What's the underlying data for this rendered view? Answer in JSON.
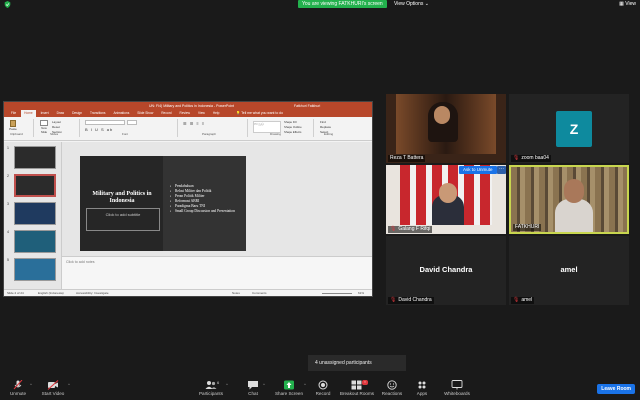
{
  "topbar": {
    "share_banner": "You are viewing FATKHURI's screen",
    "view_options": "View Options ⌄",
    "view": "View"
  },
  "powerpoint": {
    "window_title": "UN: FI4) Military and Politics in Indonesia  -  PowerPoint",
    "user": "Fatkhuri Fatkhuri",
    "tabs": [
      "File",
      "Home",
      "Insert",
      "Draw",
      "Design",
      "Transitions",
      "Animations",
      "Slide Show",
      "Record",
      "Review",
      "View",
      "Help"
    ],
    "active_tab": "Home",
    "tell_me": "Tell me what you want to do",
    "ribbon_groups": [
      "Clipboard",
      "Slides",
      "Font",
      "Paragraph",
      "Drawing",
      "Editing"
    ],
    "ribbon_items": {
      "paste": "Paste",
      "new_slide": "New Slide",
      "layout": "Layout",
      "reset": "Reset",
      "section": "Section",
      "shape_fill": "Shape Fill",
      "shape_outline": "Shape Outline",
      "shape_effects": "Shape Effects",
      "find": "Find",
      "replace": "Replace",
      "select": "Select"
    },
    "thumbnails": [
      {
        "num": "1",
        "color": "#2b2b2b",
        "selected": false
      },
      {
        "num": "2",
        "color": "#2b2b2b",
        "selected": true
      },
      {
        "num": "3",
        "color": "#1f3a5f",
        "selected": false
      },
      {
        "num": "4",
        "color": "#1f5f7a",
        "selected": false
      },
      {
        "num": "5",
        "color": "#2a6f9a",
        "selected": false
      }
    ],
    "slide": {
      "title": "Military and  Politics in Indonesia",
      "subtitle_placeholder": "Click to add subtitle",
      "bullets": [
        "Pendahuluan",
        "Relasi Militer dan Politik",
        "Peran Politik Militer",
        "Reformasi ABRI",
        "Paradigma Baru TNI",
        "Small Group Discussion and Presentation"
      ]
    },
    "notes_placeholder": "Click to add notes",
    "status": {
      "slide_count": "Slide 2 of 24",
      "language": "English (Indonesia)",
      "accessibility": "Accessibility: Investigate",
      "notes": "Notes",
      "comments": "Comments",
      "zoom": "61%"
    }
  },
  "participants_tiles": [
    {
      "name": "Reza T Battera",
      "type": "video",
      "muted": false
    },
    {
      "name": "zoom baa04",
      "type": "avatar",
      "initial": "Z",
      "muted": true
    },
    {
      "name": "Galang F Rifqi",
      "type": "video",
      "muted": true
    },
    {
      "name": "FATKHURI",
      "type": "video",
      "muted": false
    },
    {
      "name": "David Chandra",
      "type": "name",
      "muted": true
    },
    {
      "name": "amel",
      "type": "name",
      "muted": true
    }
  ],
  "unmute_button": "Ask to Unmute",
  "more_button": "···",
  "unassigned": "4 unassigned participants",
  "toolbar": {
    "unmute": "Unmute",
    "start_video": "Start Video",
    "participants": "Participants",
    "participants_count": "6",
    "chat": "Chat",
    "share_screen": "Share Screen",
    "record": "Record",
    "breakout_rooms": "Breakout Rooms",
    "reactions": "Reactions",
    "apps": "Apps",
    "whiteboards": "Whiteboards",
    "leave": "Leave Room"
  },
  "colors": {
    "accent": "#1a73e8",
    "share_green": "#23b14d",
    "powerpoint_red": "#b7472a",
    "active_speaker": "#c8d64f",
    "muted_red": "#e0383e"
  }
}
